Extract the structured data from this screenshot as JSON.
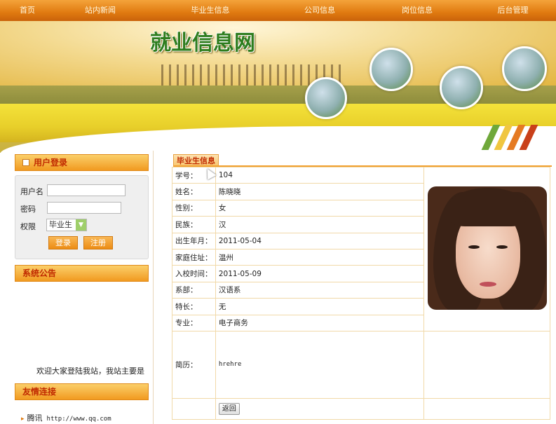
{
  "nav": {
    "items": [
      {
        "label": "首页"
      },
      {
        "label": "站内新闻"
      },
      {
        "label": "毕业生信息"
      },
      {
        "label": "公司信息"
      },
      {
        "label": "岗位信息"
      },
      {
        "label": "后台管理"
      }
    ]
  },
  "banner": {
    "title": "就业信息网"
  },
  "login": {
    "heading": "用户登录",
    "username_label": "用户名",
    "username_value": "",
    "password_label": "密码",
    "password_value": "",
    "role_label": "权限",
    "role_selected": "毕业生",
    "login_button": "登录",
    "register_button": "注册"
  },
  "announcement": {
    "heading": "系统公告",
    "text": "欢迎大家登陆我站，我站主要是"
  },
  "links": {
    "heading": "友情连接",
    "items": [
      {
        "name": "腾讯",
        "url": "http://www.qq.com"
      }
    ]
  },
  "graduate": {
    "tab_label": "毕业生信息",
    "fields": [
      {
        "label": "学号：",
        "value": "104"
      },
      {
        "label": "姓名：",
        "value": "陈晓晓"
      },
      {
        "label": "性别：",
        "value": "女"
      },
      {
        "label": "民族：",
        "value": "汉"
      },
      {
        "label": "出生年月：",
        "value": "2011-05-04"
      },
      {
        "label": "家庭住址：",
        "value": "温州"
      },
      {
        "label": "入校时间：",
        "value": "2011-05-09"
      },
      {
        "label": "系部：",
        "value": "汉语系"
      },
      {
        "label": "特长：",
        "value": "无"
      },
      {
        "label": "专业：",
        "value": "电子商务"
      }
    ],
    "resume_label": "简历：",
    "resume_value": "hrehre",
    "back_button": "返回"
  },
  "colors": {
    "nav_orange": "#e07a10",
    "heading_red": "#c02a00",
    "title_green": "#2e7d1e",
    "table_border": "#f1d9a8"
  },
  "icons": [
    "mouse-cursor-icon",
    "dropdown-arrow-icon",
    "bullet-icon"
  ]
}
